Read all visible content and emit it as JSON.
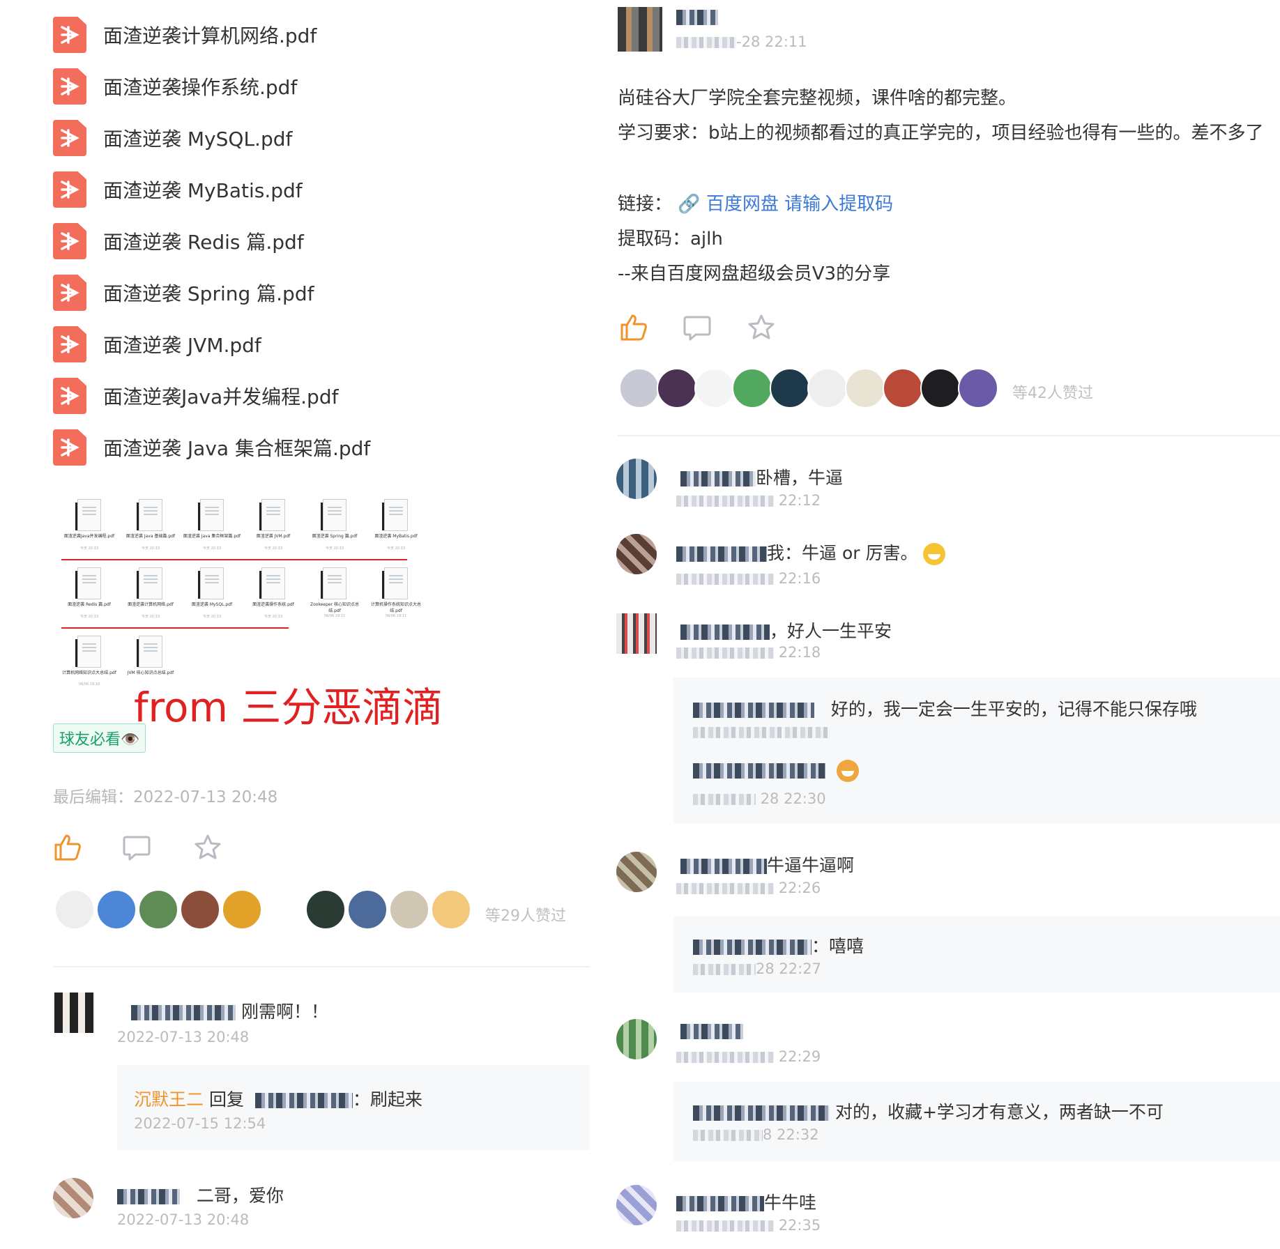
{
  "left": {
    "files": [
      "面渣逆袭计算机网络.pdf",
      "面渣逆袭操作系统.pdf",
      "面渣逆袭 MySQL.pdf",
      "面渣逆袭 MyBatis.pdf",
      "面渣逆袭 Redis 篇.pdf",
      "面渣逆袭 Spring 篇.pdf",
      "面渣逆袭 JVM.pdf",
      "面渣逆袭Java并发编程.pdf",
      "面渣逆袭 Java 集合框架篇.pdf"
    ],
    "thumbnails": [
      {
        "caption": "面渣逆袭Java并发编程.pdf",
        "sub": "今天 20:33"
      },
      {
        "caption": "面渣逆袭 Java 基础篇.pdf",
        "sub": "今天 20:33"
      },
      {
        "caption": "面渣逆袭 Java 集合框架篇.pdf",
        "sub": "今天 20:33"
      },
      {
        "caption": "面渣逆袭 JVM.pdf",
        "sub": "今天 20:33"
      },
      {
        "caption": "面渣逆袭 Spring 篇.pdf",
        "sub": "今天 20:33"
      },
      {
        "caption": "面渣逆袭 MyBatis.pdf",
        "sub": "今天 20:33"
      },
      {
        "caption": "面渣逆袭 Redis 篇.pdf",
        "sub": "今天 20:33"
      },
      {
        "caption": "面渣逆袭计算机网络.pdf",
        "sub": "今天 20:33"
      },
      {
        "caption": "面渣逆袭 MySQL.pdf",
        "sub": "今天 20:33"
      },
      {
        "caption": "面渣逆袭操作系统.pdf",
        "sub": "今天 20:33"
      },
      {
        "caption": "Zookeeper 核心知识点总结.pdf",
        "sub": "06/06 19:11"
      },
      {
        "caption": "计算机操作系统知识点大总结.pdf",
        "sub": "06/06 19:11"
      },
      {
        "caption": "计算机网络知识点大总结.pdf",
        "sub": "06/06 19:10"
      },
      {
        "caption": "JVM 核心知识点总结.pdf",
        "sub": ""
      }
    ],
    "watermark": "from 三分恶滴滴",
    "tag": "球友必看👁️",
    "last_edit": "最后编辑：2022-07-13 20:48",
    "like_count": "等29人赞过",
    "comments": [
      {
        "text": "刚需啊！！",
        "time": "2022-07-13 20:48"
      },
      {
        "text": "二哥，爱你",
        "time": "2022-07-13 20:48"
      }
    ],
    "reply": {
      "author": "沉默王二",
      "verb": "回复",
      "text": "：刷起来",
      "time": "2022-07-15 12:54"
    }
  },
  "right": {
    "post_time": "-28 22:11",
    "body": [
      "尚硅谷大厂学院全套完整视频，课件啥的都完整。",
      "学习要求：b站上的视频都看过的真正学完的，项目经验也得有一些的。差不多了"
    ],
    "link_label": "链接：",
    "link_text": "百度网盘 请输入提取码",
    "code_line": "提取码：ajlh",
    "share_line": "--来自百度网盘超级会员V3的分享",
    "like_count": "等42人赞过",
    "comments": [
      {
        "text": "卧槽，牛逼",
        "time": "22:12"
      },
      {
        "text": "我：牛逼 or 厉害。",
        "time": "22:16"
      },
      {
        "text": "，好人一生平安",
        "time": "22:18"
      },
      {
        "text": "牛逼牛逼啊",
        "time": "22:26"
      },
      {
        "text": "",
        "time": "22:29"
      },
      {
        "text": "牛牛哇",
        "time": "22:35"
      }
    ],
    "replies": [
      {
        "text": "好的，我一定会一生平安的，记得不能只保存哦",
        "time": ""
      },
      {
        "text": "",
        "time": "28 22:30"
      },
      {
        "text": "：嘻嘻",
        "time": "28 22:27"
      },
      {
        "text": "对的，收藏+学习才有意义，两者缺一不可",
        "time": "8 22:32"
      }
    ]
  },
  "colors": {
    "pdf_red": "#f26d5b",
    "watermark_red": "#e12121",
    "like_orange": "#f0932b",
    "link_blue": "#3b7ad8",
    "tag_green": "#16a06a"
  }
}
